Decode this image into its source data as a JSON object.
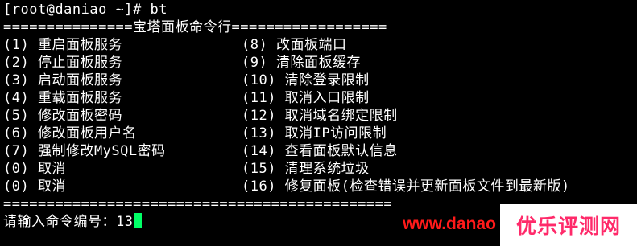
{
  "prompt_line": "[root@daniao ~]# bt",
  "header_line": "===============宝塔面板命令行==================",
  "menu_left": [
    "(1) 重启面板服务",
    "(2) 停止面板服务",
    "(3) 启动面板服务",
    "(4) 重载面板服务",
    "(5) 修改面板密码",
    "(6) 修改面板用户名",
    "(7) 强制修改MySQL密码",
    "(0) 取消",
    "(0) 取消"
  ],
  "menu_right": [
    "(8) 改面板端口",
    "(9) 清除面板缓存",
    "(10) 清除登录限制",
    "(11) 取消入口限制",
    "(12) 取消域名绑定限制",
    "(13) 取消IP访问限制",
    "(14) 查看面板默认信息",
    "(15) 清理系统垃圾",
    "(16) 修复面板(检查错误并更新面板文件到最新版)"
  ],
  "footer_line": "=============================================",
  "input_prompt": "请输入命令编号：",
  "input_value": "13",
  "watermark": {
    "url_text": "www.danao",
    "logo_text": "优乐评测网",
    "url_color": "#ff1a1a",
    "logo_color": "#ff2a6a"
  },
  "colors": {
    "background": "#000000",
    "text": "#ffffff",
    "cursor": "#00ff66"
  }
}
